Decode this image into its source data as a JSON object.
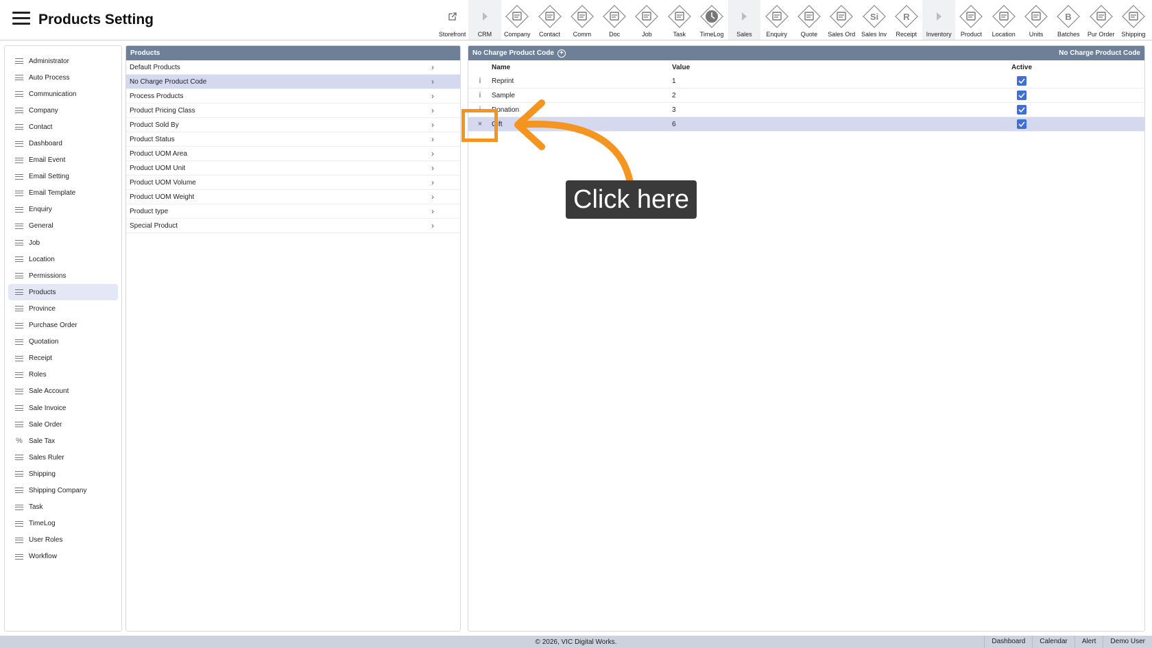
{
  "header": {
    "title": "Products Setting",
    "menu_icon": "hamburger-icon"
  },
  "toolbar": [
    {
      "label": "Storefront",
      "icon": "external-link-icon"
    },
    {
      "label": "CRM",
      "icon": "caret-right-icon"
    },
    {
      "label": "Company",
      "icon": "company-icon"
    },
    {
      "label": "Contact",
      "icon": "contact-icon"
    },
    {
      "label": "Comm",
      "icon": "comm-icon"
    },
    {
      "label": "Doc",
      "icon": "doc-icon"
    },
    {
      "label": "Job",
      "icon": "job-icon"
    },
    {
      "label": "Task",
      "icon": "task-icon"
    },
    {
      "label": "TimeLog",
      "icon": "clock-icon"
    },
    {
      "label": "Sales",
      "icon": "caret-right-icon"
    },
    {
      "label": "Enquiry",
      "icon": "enquiry-icon"
    },
    {
      "label": "Quote",
      "icon": "quote-icon"
    },
    {
      "label": "Sales Ord",
      "icon": "sales-order-icon"
    },
    {
      "label": "Sales Inv",
      "icon": "sales-invoice-icon"
    },
    {
      "label": "Receipt",
      "icon": "receipt-icon"
    },
    {
      "label": "Inventory",
      "icon": "caret-right-icon"
    },
    {
      "label": "Product",
      "icon": "product-icon"
    },
    {
      "label": "Location",
      "icon": "location-icon"
    },
    {
      "label": "Units",
      "icon": "units-icon"
    },
    {
      "label": "Batches",
      "icon": "batches-icon"
    },
    {
      "label": "Pur Order",
      "icon": "purchase-order-icon"
    },
    {
      "label": "Shipping",
      "icon": "shipping-icon"
    }
  ],
  "sidebar": {
    "items": [
      "Administrator",
      "Auto Process",
      "Communication",
      "Company",
      "Contact",
      "Dashboard",
      "Email Event",
      "Email Setting",
      "Email Template",
      "Enquiry",
      "General",
      "Job",
      "Location",
      "Permissions",
      "Products",
      "Province",
      "Purchase Order",
      "Quotation",
      "Receipt",
      "Roles",
      "Sale Account",
      "Sale Invoice",
      "Sale Order",
      "Sale Tax",
      "Sales Ruler",
      "Shipping",
      "Shipping Company",
      "Task",
      "TimeLog",
      "User Roles",
      "Workflow"
    ],
    "active": "Products"
  },
  "products_panel": {
    "title": "Products",
    "items": [
      "Default Products",
      "No Charge Product Code",
      "Process Products",
      "Product Pricing Class",
      "Product Sold By",
      "Product Status",
      "Product UOM Area",
      "Product UOM Unit",
      "Product UOM Volume",
      "Product UOM Weight",
      "Product type",
      "Special Product"
    ],
    "active": "No Charge Product Code"
  },
  "detail_panel": {
    "title": "No Charge Product Code",
    "title_right": "No Charge Product Code",
    "columns": {
      "name": "Name",
      "value": "Value",
      "active": "Active"
    },
    "rows": [
      {
        "action": "i",
        "name": "Reprint",
        "value": "1",
        "active": true,
        "selected": false
      },
      {
        "action": "i",
        "name": "Sample",
        "value": "2",
        "active": true,
        "selected": false
      },
      {
        "action": "i",
        "name": "Donation",
        "value": "3",
        "active": true,
        "selected": false
      },
      {
        "action": "×",
        "name": "Gift",
        "value": "6",
        "active": true,
        "selected": true
      }
    ]
  },
  "footer": {
    "copyright": "© 2026, VIC Digital Works.",
    "links": [
      "Dashboard",
      "Calendar",
      "Alert",
      "Demo User"
    ]
  },
  "tutorial": {
    "callout_text": "Click here",
    "accent_color": "#f5941f"
  }
}
